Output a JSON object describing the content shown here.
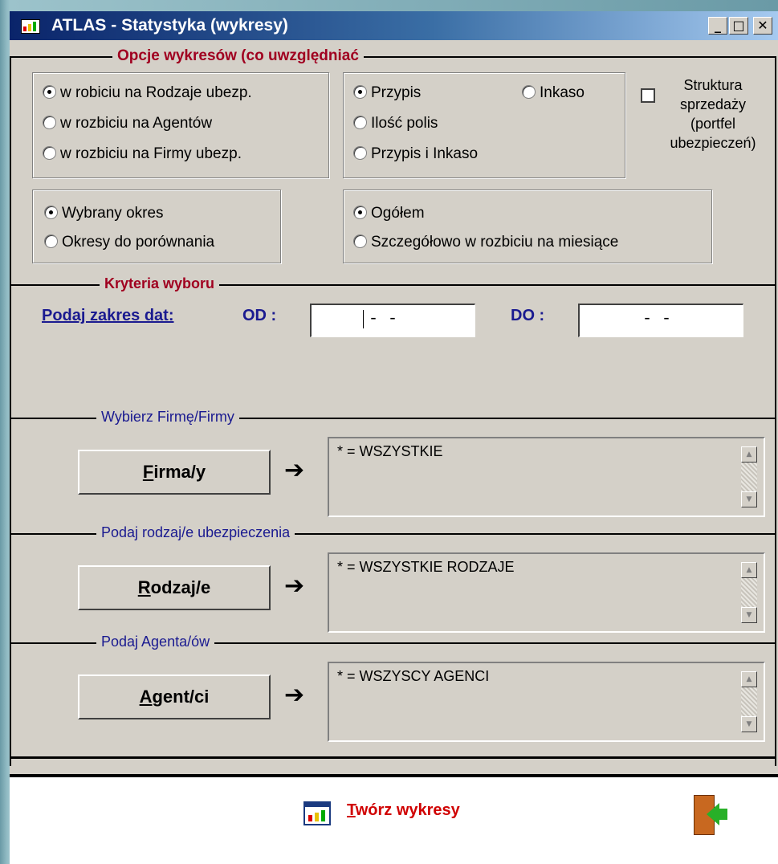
{
  "window": {
    "title": "ATLAS - Statystyka (wykresy)"
  },
  "titlebar_buttons": {
    "minimize": "_",
    "maximize": "□",
    "close": "✕"
  },
  "options": {
    "title": "Opcje wykresów (co uwzględniać",
    "group1": [
      "w robiciu na Rodzaje ubezp.",
      "w rozbiciu na Agentów",
      "w rozbiciu na Firmy ubezp."
    ],
    "group2": {
      "przypis": "Przypis",
      "inkaso": "Inkaso",
      "ilosc": "Ilość polis",
      "both": "Przypis i Inkaso"
    },
    "structure_label": [
      "Struktura",
      "sprzedaży",
      "(portfel",
      "ubezpieczeń)"
    ],
    "group3": [
      "Wybrany okres",
      "Okresy do porównania"
    ],
    "group4": [
      "Ogółem",
      "Szczegółowo w rozbiciu na miesiące"
    ]
  },
  "criteria": {
    "title": "Kryteria wyboru",
    "date_range_label": "Podaj zakres dat:",
    "from_label": "OD :",
    "from_value": "- -",
    "to_label": "DO :",
    "to_value": "- -"
  },
  "firm": {
    "title": "Wybierz Firmę/Firmy",
    "button_first": "F",
    "button_rest": "irma/y",
    "list_text": "* = WSZYSTKIE"
  },
  "kind": {
    "title": "Podaj rodzaj/e ubezpieczenia",
    "button_first": "R",
    "button_rest": "odzaj/e",
    "list_text": "* = WSZYSTKIE RODZAJE"
  },
  "agent": {
    "title": "Podaj  Agenta/ów",
    "button_first": "A",
    "button_rest": "gent/ci",
    "list_text": "* = WSZYSCY AGENCI"
  },
  "arrow": "➔",
  "scroll": {
    "up": "▲",
    "down": "▼"
  },
  "footer": {
    "create_first": "T",
    "create_rest": "wórz wykresy"
  },
  "colors": {
    "title_red": "#a00020",
    "label_blue": "#1a1a90",
    "link_red": "#d00000",
    "face": "#d4d0c8"
  }
}
